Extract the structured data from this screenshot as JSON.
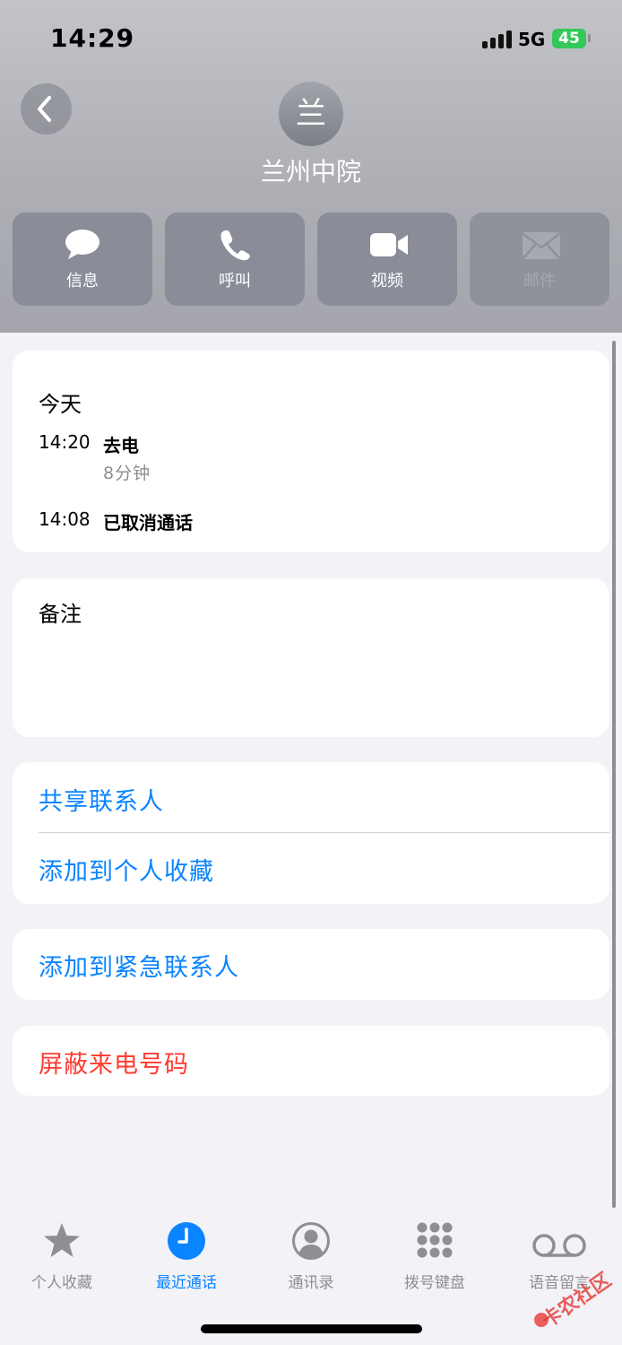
{
  "status_bar": {
    "time": "14:29",
    "network": "5G",
    "battery": "45"
  },
  "contact": {
    "avatar_initial": "兰",
    "name": "兰州中院"
  },
  "actions": [
    {
      "label": "信息",
      "icon": "message-icon",
      "enabled": true
    },
    {
      "label": "呼叫",
      "icon": "phone-icon",
      "enabled": true
    },
    {
      "label": "视频",
      "icon": "video-icon",
      "enabled": true
    },
    {
      "label": "邮件",
      "icon": "mail-icon",
      "enabled": false
    }
  ],
  "history": {
    "title": "今天",
    "entries": [
      {
        "time": "14:20",
        "type": "去电",
        "duration": "8分钟"
      },
      {
        "time": "14:08",
        "type": "已取消通话",
        "duration": ""
      }
    ]
  },
  "notes": {
    "title": "备注"
  },
  "options": {
    "share_contact": "共享联系人",
    "add_favorites": "添加到个人收藏",
    "add_emergency": "添加到紧急联系人",
    "block_caller": "屏蔽来电号码"
  },
  "tabs": [
    {
      "label": "个人收藏",
      "icon": "star-icon",
      "active": false
    },
    {
      "label": "最近通话",
      "icon": "clock-icon",
      "active": true
    },
    {
      "label": "通讯录",
      "icon": "contact-icon",
      "active": false
    },
    {
      "label": "拨号键盘",
      "icon": "keypad-icon",
      "active": false
    },
    {
      "label": "语音留言",
      "icon": "voicemail-icon",
      "active": false
    }
  ],
  "colors": {
    "accent": "#0a84ff",
    "destructive": "#ff3b30",
    "battery": "#34c759"
  }
}
